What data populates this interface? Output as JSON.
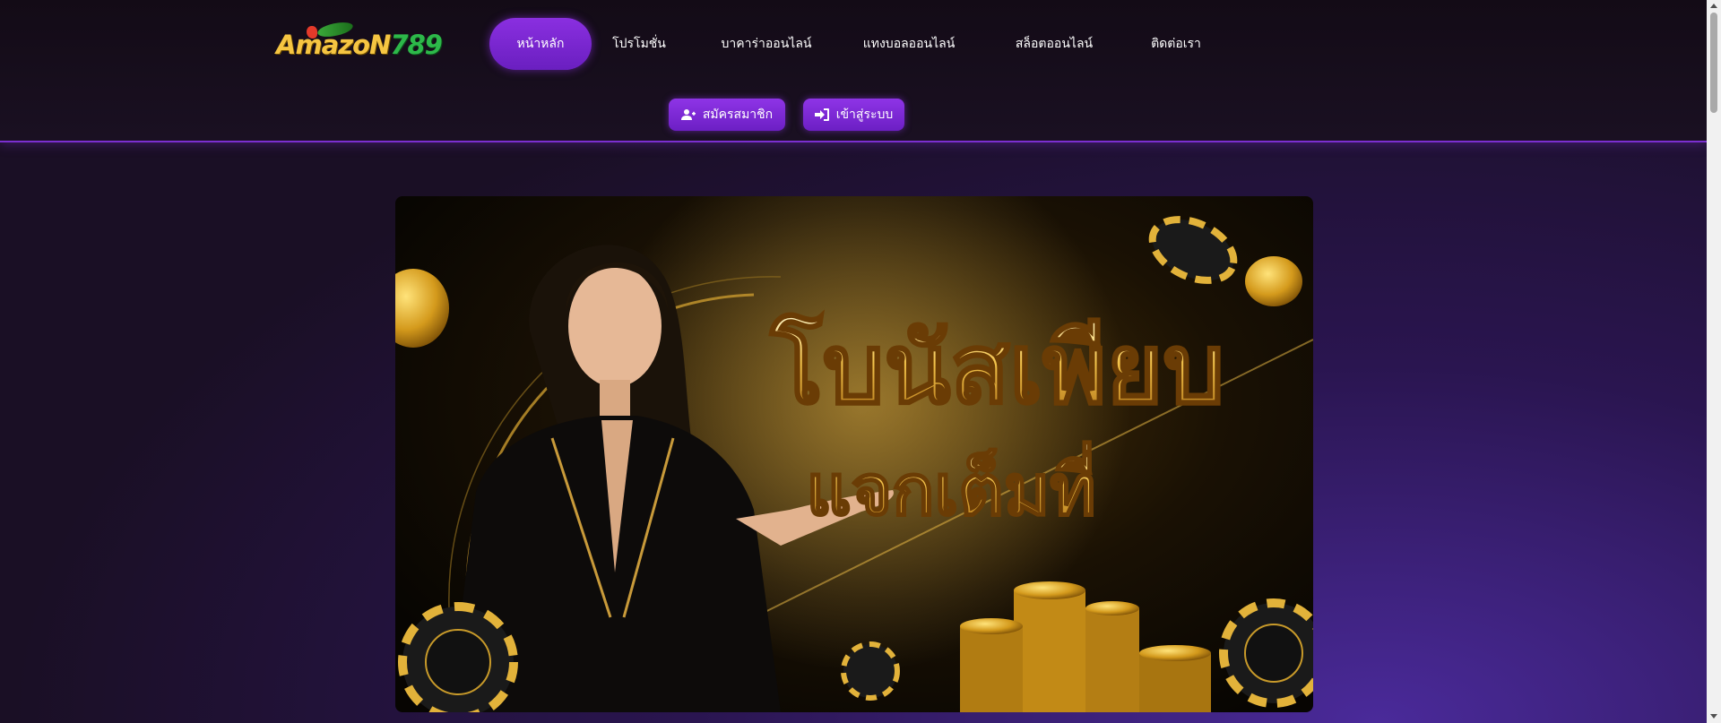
{
  "logo": {
    "prefix": "AmazoN",
    "suffix": "789"
  },
  "nav": {
    "items": [
      {
        "label": "หน้าหลัก",
        "active": true
      },
      {
        "label": "โปรโมชั่น",
        "active": false
      },
      {
        "label": "บาคาร่าออนไลน์",
        "active": false
      },
      {
        "label": "แทงบอลออนไลน์",
        "active": false
      },
      {
        "label": "สล็อตออนไลน์",
        "active": false
      },
      {
        "label": "ติดต่อเรา",
        "active": false
      }
    ]
  },
  "actions": {
    "register_label": "สมัครสมาชิก",
    "login_label": "เข้าสู่ระบบ"
  },
  "banner": {
    "headline": "โบนัสเพียบ",
    "subline": "แจกเต็มที่"
  },
  "colors": {
    "accent": "#7b2fd0",
    "gold": "#f5c542",
    "background": "#170d1c"
  },
  "icons": {
    "register": "user-plus-icon",
    "login": "sign-in-icon"
  }
}
